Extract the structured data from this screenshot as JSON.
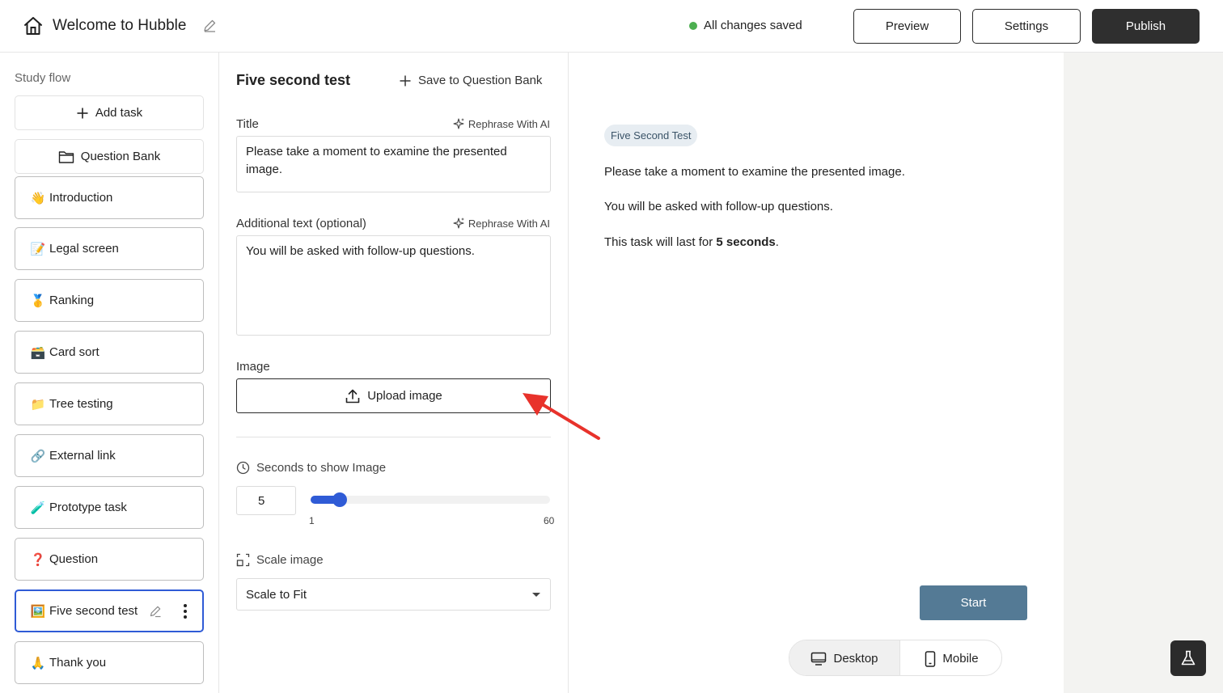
{
  "header": {
    "title": "Welcome to Hubble",
    "save_status": "All changes saved",
    "preview_label": "Preview",
    "settings_label": "Settings",
    "publish_label": "Publish"
  },
  "sidebar": {
    "section_label": "Study flow",
    "add_task_label": "Add task",
    "question_bank_label": "Question Bank",
    "tasks": [
      {
        "emoji": "👋",
        "label": "Introduction"
      },
      {
        "emoji": "📝",
        "label": "Legal screen"
      },
      {
        "emoji": "🥇",
        "label": "Ranking"
      },
      {
        "emoji": "🗃️",
        "label": "Card sort"
      },
      {
        "emoji": "📁",
        "label": "Tree testing"
      },
      {
        "emoji": "🔗",
        "label": "External link"
      },
      {
        "emoji": "🧪",
        "label": "Prototype task"
      },
      {
        "emoji": "❓",
        "label": "Question"
      },
      {
        "emoji": "🖼️",
        "label": "Five second test",
        "active": true
      },
      {
        "emoji": "🙏",
        "label": "Thank you"
      }
    ]
  },
  "editor": {
    "heading": "Five second test",
    "save_to_bank_label": "Save to Question Bank",
    "title_label": "Title",
    "rephrase_label": "Rephrase With AI",
    "title_value": "Please take a moment to examine the presented image.",
    "additional_label": "Additional text (optional)",
    "additional_value": "You will be asked with follow-up questions.",
    "image_label": "Image",
    "upload_label": "Upload image",
    "seconds_label": "Seconds to show Image",
    "seconds_value": "5",
    "slider": {
      "min": 1,
      "max": 60,
      "value": 5,
      "min_label": "1",
      "max_label": "60"
    },
    "scale_label": "Scale image",
    "scale_value": "Scale to Fit"
  },
  "preview": {
    "badge": "Five Second Test",
    "line1": "Please take a moment to examine the presented image.",
    "line2": "You will be asked with follow-up questions.",
    "line3_prefix": "This task will last for ",
    "line3_bold": "5 seconds",
    "line3_suffix": ".",
    "start_label": "Start",
    "desktop_label": "Desktop",
    "mobile_label": "Mobile"
  },
  "colors": {
    "accent": "#2f5bd6",
    "publish_bg": "#2f2f2f",
    "start_bg": "#547a95",
    "saved_dot": "#4caf50",
    "annotation_arrow": "#e8322b"
  }
}
